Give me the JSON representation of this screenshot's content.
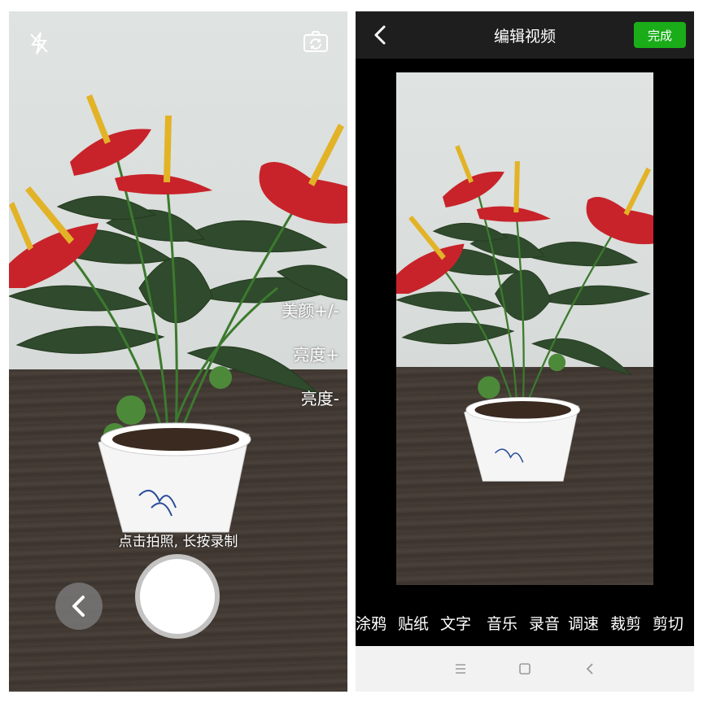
{
  "camera": {
    "icons": {
      "flash": "flash-off-icon",
      "switch": "camera-switch-icon",
      "back": "chevron-left-icon"
    },
    "options": {
      "beauty": "美颜+/-",
      "brightness_up": "亮度+",
      "brightness_down": "亮度-"
    },
    "hint": "点击拍照, 长按录制"
  },
  "editor": {
    "title": "编辑视频",
    "done_label": "完成",
    "tools": [
      "涂鸦",
      "贴纸",
      "文字",
      "音乐",
      "录音",
      "调速",
      "裁剪",
      "剪切"
    ]
  },
  "system_nav": {
    "icons": [
      "menu-icon",
      "home-icon",
      "back-icon"
    ]
  },
  "colors": {
    "accent_green": "#1aad19",
    "editor_bar": "#1e1e1e",
    "flower_red": "#c8232a",
    "spadix_yellow": "#e2b327"
  }
}
